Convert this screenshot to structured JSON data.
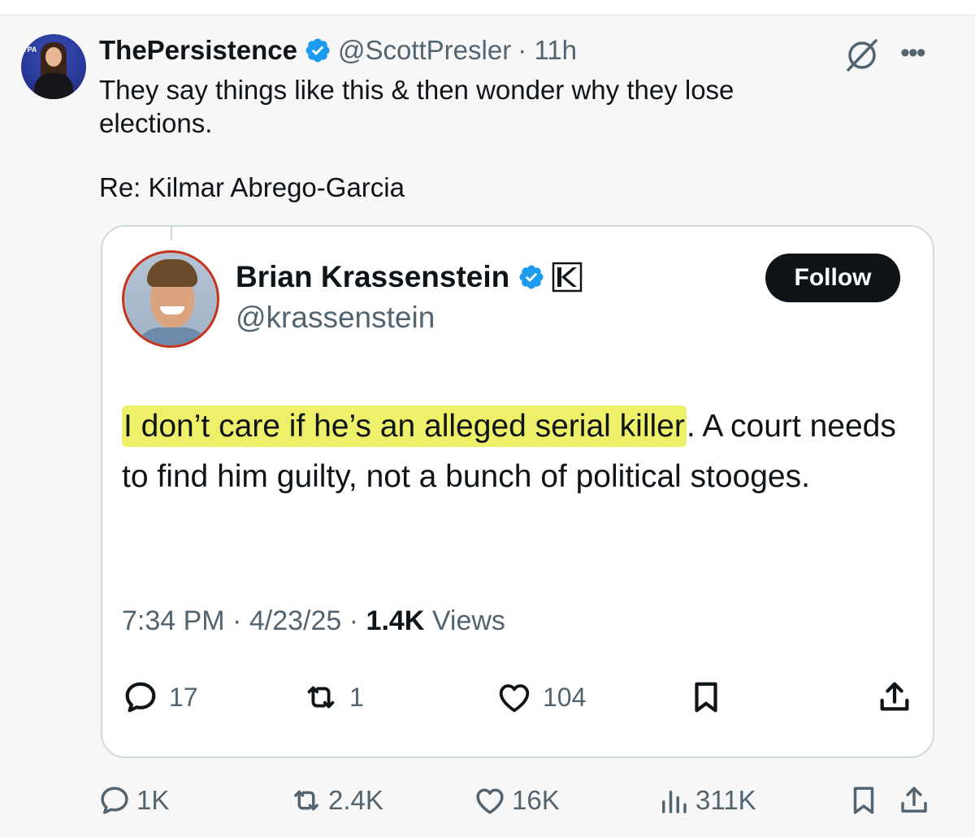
{
  "tweet": {
    "display_name": "ThePersistence",
    "handle": "@ScottPresler",
    "time": "· 11h",
    "text": "They say things like this & then wonder why they lose elections.",
    "re": "Re: Kilmar Abrego-Garcia",
    "avatar_badge_text": "TPA"
  },
  "quoted": {
    "display_name": "Brian Krassenstein",
    "handle": "@krassenstein",
    "follow_label": "Follow",
    "text_highlighted": "I don’t care if he’s an alleged serial killer",
    "text_rest": ". A court needs to find him guilty, not a bunch of political stooges.",
    "time": "7:34 PM",
    "date": "4/23/25",
    "views_count": "1.4K",
    "views_label": "Views",
    "replies": "17",
    "reposts": "1",
    "likes": "104",
    "highlight_color": "#eef06a"
  },
  "actions": {
    "replies": "1K",
    "reposts": "2.4K",
    "likes": "16K",
    "views": "311K"
  },
  "colors": {
    "text": "#0f1419",
    "secondary": "#536471",
    "verified": "#1d9bf0",
    "border": "#cfd9de"
  },
  "icons": [
    "verified-icon",
    "grok-icon",
    "more-icon",
    "k-badge-icon",
    "reply-icon",
    "repost-icon",
    "like-icon",
    "bookmark-icon",
    "share-icon",
    "views-icon"
  ]
}
